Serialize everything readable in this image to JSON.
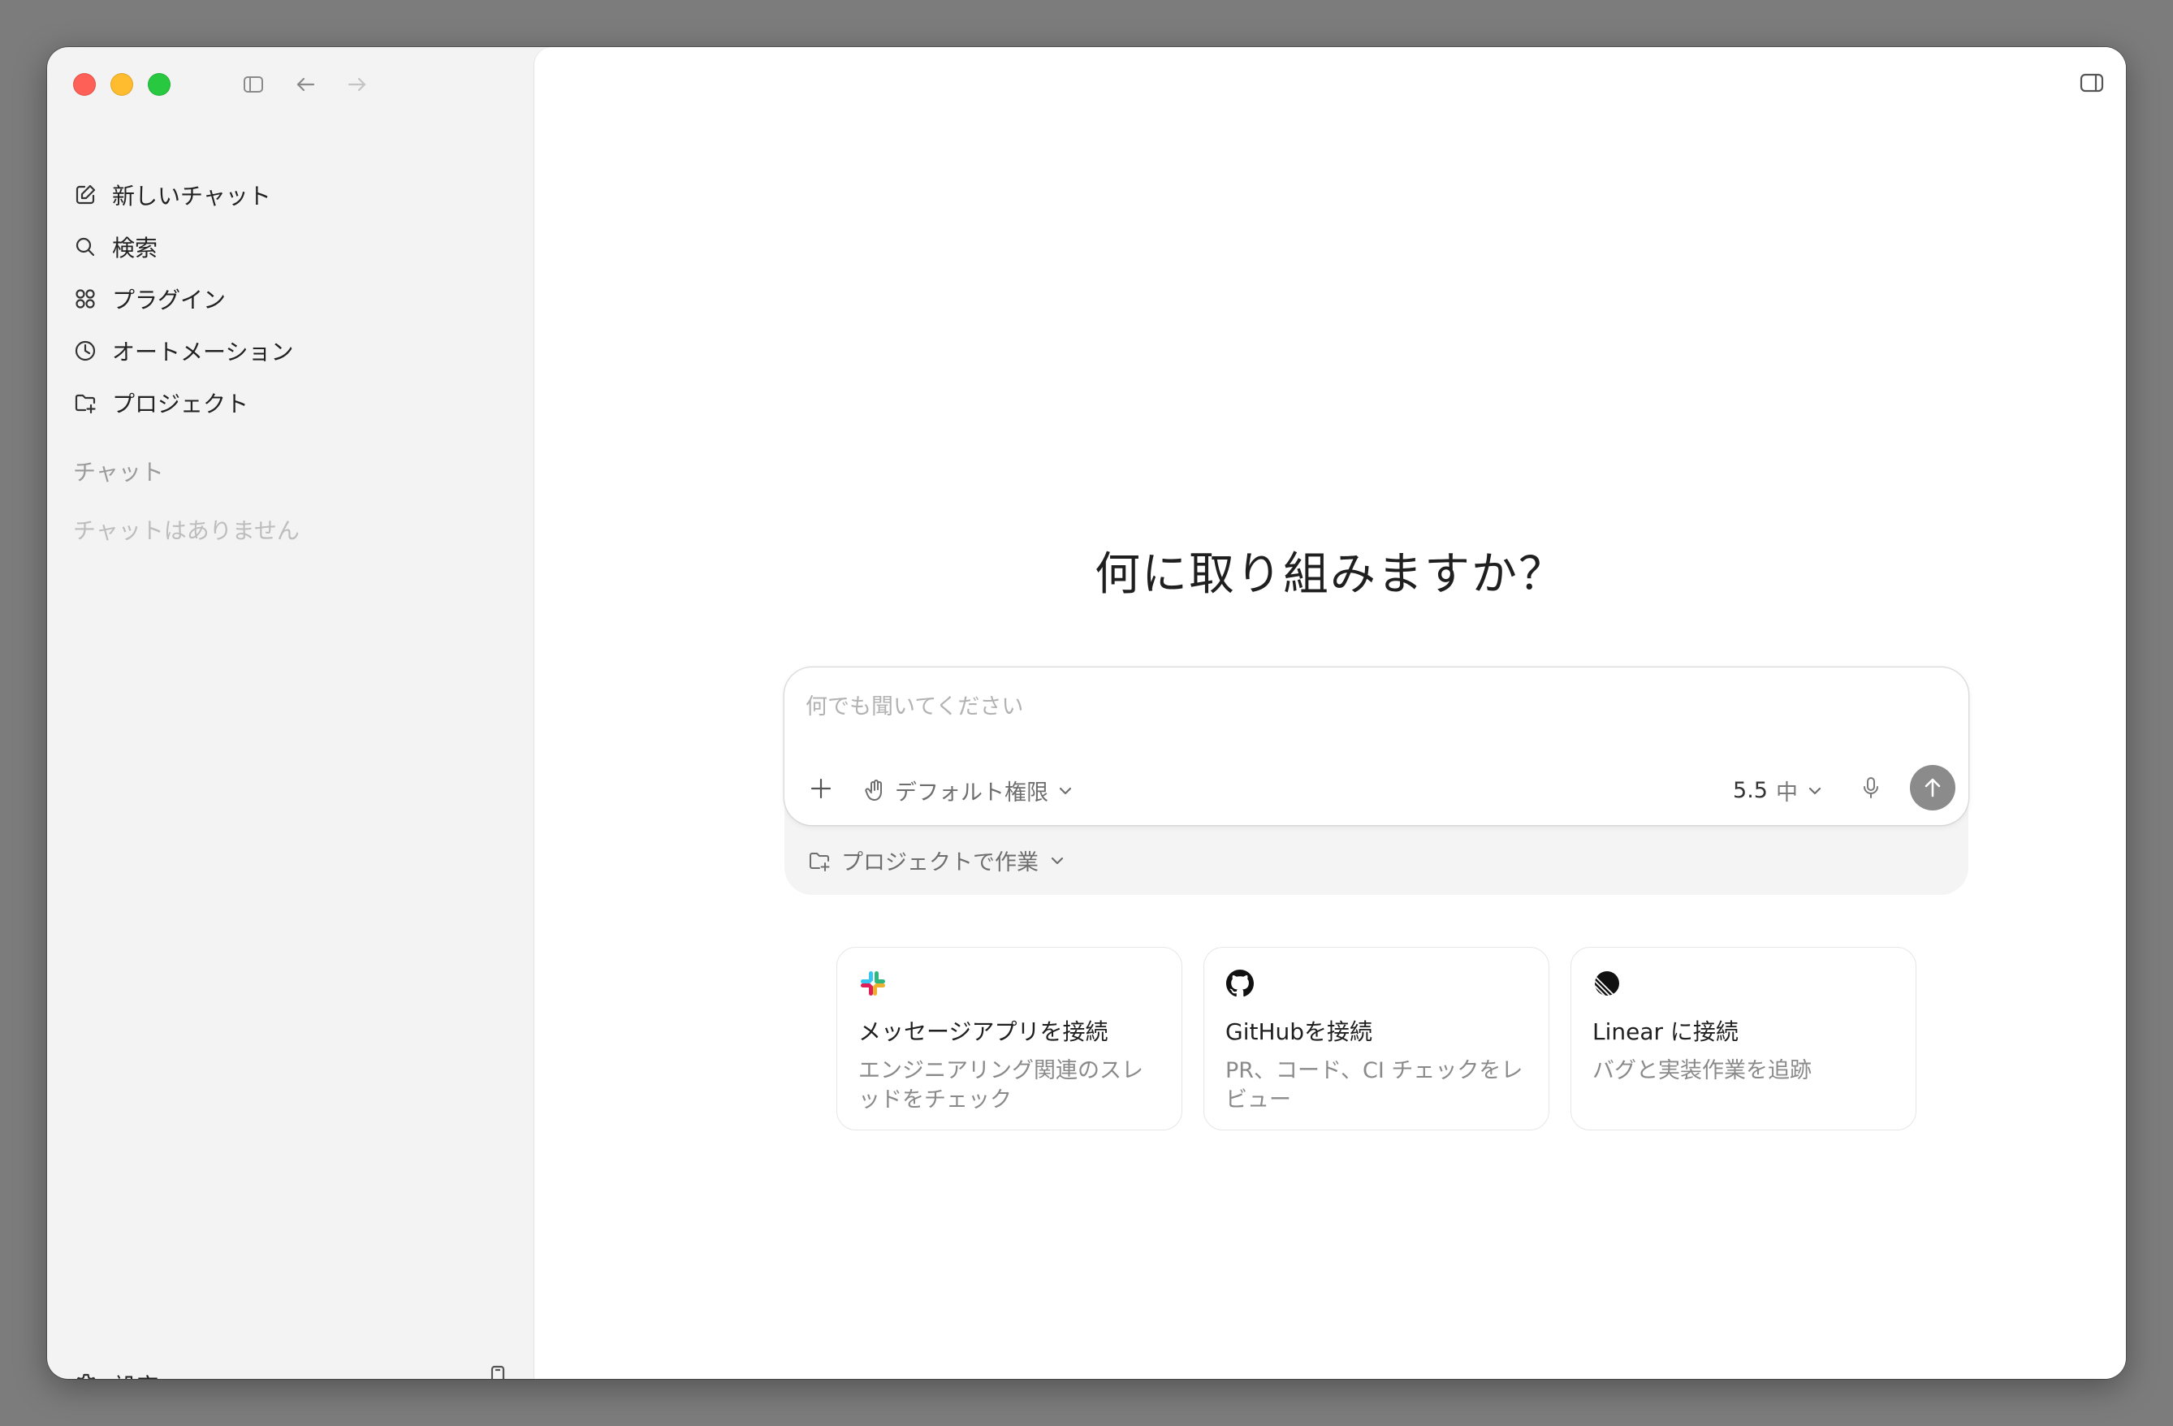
{
  "sidebar": {
    "nav": [
      {
        "label": "新しいチャット",
        "icon": "edit-icon"
      },
      {
        "label": "検索",
        "icon": "search-icon"
      },
      {
        "label": "プラグイン",
        "icon": "grid-icon"
      },
      {
        "label": "オートメーション",
        "icon": "clock-icon"
      },
      {
        "label": "プロジェクト",
        "icon": "folder-add-icon"
      }
    ],
    "section_label": "チャット",
    "empty_label": "チャットはありません",
    "settings_label": "設定"
  },
  "main": {
    "heading": "何に取り組みますか？",
    "composer": {
      "placeholder": "何でも聞いてください",
      "permission_label": "デフォルト権限",
      "model_version": "5.5",
      "effort_label": "中",
      "project_label": "プロジェクトで作業"
    },
    "cards": [
      {
        "icon": "slack-icon",
        "title": "メッセージアプリを接続",
        "desc": "エンジニアリング関連のスレッドをチェック"
      },
      {
        "icon": "github-icon",
        "title": "GitHubを接続",
        "desc": "PR、コード、CI チェックをレビュー"
      },
      {
        "icon": "linear-icon",
        "title": "Linear に接続",
        "desc": "バグと実装作業を追跡"
      }
    ]
  },
  "colors": {
    "close": "#fe5f57",
    "minimize": "#febc2e",
    "zoom": "#28c840",
    "send_button": "#8b8b8b",
    "sidebar_bg": "#f3f3f4",
    "desktop_bg": "#7c7c7c"
  }
}
